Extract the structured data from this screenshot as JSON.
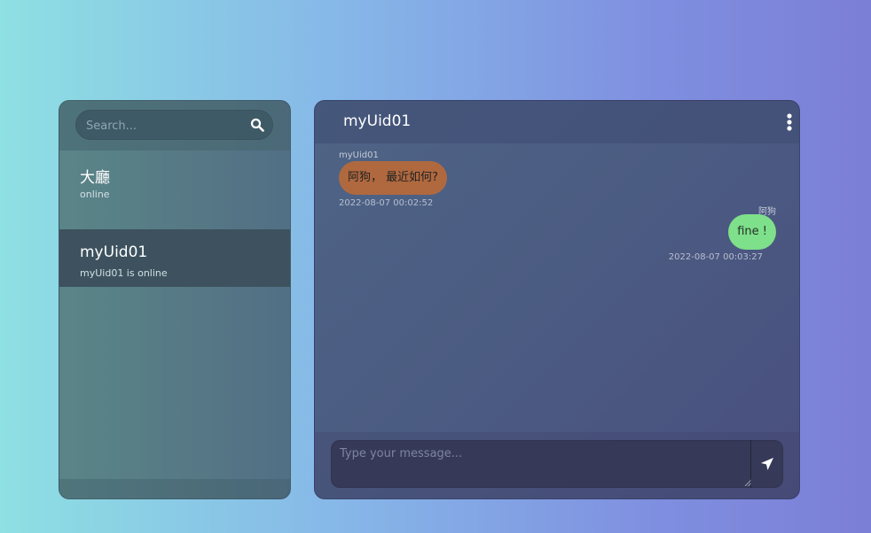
{
  "sidebar": {
    "search": {
      "placeholder": "Search...",
      "icon": "search-icon"
    },
    "rooms": [
      {
        "name": "大廳",
        "status": "online"
      },
      {
        "name": "myUid01",
        "status": "myUid01 is online"
      }
    ]
  },
  "chat": {
    "title": "myUid01",
    "menu_icon": "kebab-icon",
    "messages": [
      {
        "sender": "myUid01",
        "text": "阿狗， 最近如何?",
        "time": "2022-08-07 00:02:52",
        "side": "left"
      },
      {
        "sender": "阿狗",
        "text": "fine !",
        "time": "2022-08-07 00:03:27",
        "side": "right"
      }
    ],
    "composer": {
      "placeholder": "Type your message...",
      "send_icon": "send-icon"
    }
  },
  "colors": {
    "incoming_bubble": "#b0693f",
    "outgoing_bubble": "#7ee08a",
    "active_room": "#3d525e"
  }
}
